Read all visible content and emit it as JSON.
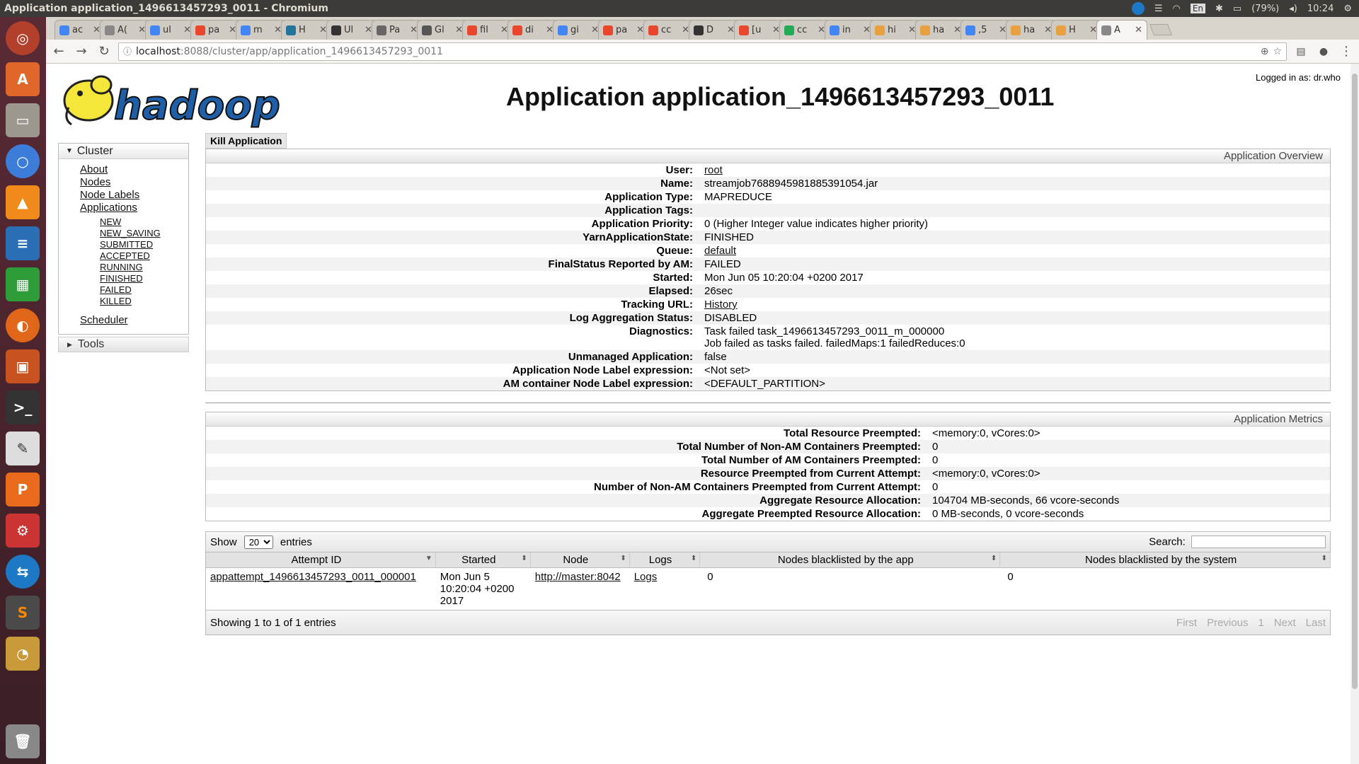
{
  "window": {
    "title": "Application application_1496613457293_0011 - Chromium"
  },
  "system": {
    "battery": "(79%)",
    "time": "10:24",
    "lang": "En"
  },
  "tabs": [
    {
      "label": "ac",
      "color": "#4285f4"
    },
    {
      "label": "A(",
      "color": "#888"
    },
    {
      "label": "ul",
      "color": "#4285f4"
    },
    {
      "label": "pa",
      "color": "#e8472c"
    },
    {
      "label": "m",
      "color": "#4285f4"
    },
    {
      "label": "H",
      "color": "#21759b"
    },
    {
      "label": "Ul",
      "color": "#333"
    },
    {
      "label": "Pa",
      "color": "#666"
    },
    {
      "label": "Gl",
      "color": "#555"
    },
    {
      "label": "fil",
      "color": "#e8472c"
    },
    {
      "label": "di",
      "color": "#e8472c"
    },
    {
      "label": "gi",
      "color": "#4285f4"
    },
    {
      "label": "pa",
      "color": "#e8472c"
    },
    {
      "label": "cc",
      "color": "#e8472c"
    },
    {
      "label": "D",
      "color": "#333"
    },
    {
      "label": "[u",
      "color": "#e8472c"
    },
    {
      "label": "cc",
      "color": "#2a5"
    },
    {
      "label": "in",
      "color": "#4285f4"
    },
    {
      "label": "hi",
      "color": "#e8a040"
    },
    {
      "label": "ha",
      "color": "#e8a040"
    },
    {
      "label": ",5",
      "color": "#4285f4"
    },
    {
      "label": "ha",
      "color": "#e8a040"
    },
    {
      "label": "H",
      "color": "#e8a040"
    },
    {
      "label": "A",
      "color": "#888"
    }
  ],
  "address": {
    "host": "localhost",
    "rest": ":8088/cluster/app/application_1496613457293_0011"
  },
  "header": {
    "title": "Application application_1496613457293_0011",
    "logged_in": "Logged in as: dr.who",
    "logo_text": "hadoop"
  },
  "nav": {
    "cluster_label": "Cluster",
    "items": [
      "About",
      "Nodes",
      "Node Labels",
      "Applications"
    ],
    "app_states": [
      "NEW",
      "NEW_SAVING",
      "SUBMITTED",
      "ACCEPTED",
      "RUNNING",
      "FINISHED",
      "FAILED",
      "KILLED"
    ],
    "scheduler": "Scheduler",
    "tools_label": "Tools"
  },
  "kill_label": "Kill Application",
  "overview": {
    "heading": "Application Overview",
    "rows": [
      {
        "k": "User:",
        "v": "root",
        "link": true
      },
      {
        "k": "Name:",
        "v": "streamjob7688945981885391054.jar"
      },
      {
        "k": "Application Type:",
        "v": "MAPREDUCE"
      },
      {
        "k": "Application Tags:",
        "v": ""
      },
      {
        "k": "Application Priority:",
        "v": "0 (Higher Integer value indicates higher priority)"
      },
      {
        "k": "YarnApplicationState:",
        "v": "FINISHED"
      },
      {
        "k": "Queue:",
        "v": "default",
        "link": true
      },
      {
        "k": "FinalStatus Reported by AM:",
        "v": "FAILED"
      },
      {
        "k": "Started:",
        "v": "Mon Jun 05 10:20:04 +0200 2017"
      },
      {
        "k": "Elapsed:",
        "v": "26sec"
      },
      {
        "k": "Tracking URL:",
        "v": "History",
        "link": true
      },
      {
        "k": "Log Aggregation Status:",
        "v": "DISABLED"
      },
      {
        "k": "Diagnostics:",
        "v": "Task failed task_1496613457293_0011_m_000000",
        "v2": "Job failed as tasks failed. failedMaps:1 failedReduces:0"
      },
      {
        "k": "Unmanaged Application:",
        "v": "false"
      },
      {
        "k": "Application Node Label expression:",
        "v": "<Not set>"
      },
      {
        "k": "AM container Node Label expression:",
        "v": "<DEFAULT_PARTITION>"
      }
    ]
  },
  "metrics": {
    "heading": "Application Metrics",
    "rows": [
      {
        "k": "Total Resource Preempted:",
        "v": "<memory:0, vCores:0>"
      },
      {
        "k": "Total Number of Non-AM Containers Preempted:",
        "v": "0"
      },
      {
        "k": "Total Number of AM Containers Preempted:",
        "v": "0"
      },
      {
        "k": "Resource Preempted from Current Attempt:",
        "v": "<memory:0, vCores:0>"
      },
      {
        "k": "Number of Non-AM Containers Preempted from Current Attempt:",
        "v": "0"
      },
      {
        "k": "Aggregate Resource Allocation:",
        "v": "104704 MB-seconds, 66 vcore-seconds"
      },
      {
        "k": "Aggregate Preempted Resource Allocation:",
        "v": "0 MB-seconds, 0 vcore-seconds"
      }
    ]
  },
  "attempts": {
    "show_label": "Show",
    "entries_value": "20",
    "entries_label": "entries",
    "search_label": "Search:",
    "columns": [
      "Attempt ID",
      "Started",
      "Node",
      "Logs",
      "Nodes blacklisted by the app",
      "Nodes blacklisted by the system"
    ],
    "rows": [
      {
        "id": "appattempt_1496613457293_0011_000001",
        "started": "Mon Jun 5 10:20:04 +0200 2017",
        "node": "http://master:8042",
        "logs": "Logs",
        "bl_app": "0",
        "bl_sys": "0"
      }
    ],
    "footer": "Showing 1 to 1 of 1 entries",
    "pager": [
      "First",
      "Previous",
      "1",
      "Next",
      "Last"
    ]
  }
}
